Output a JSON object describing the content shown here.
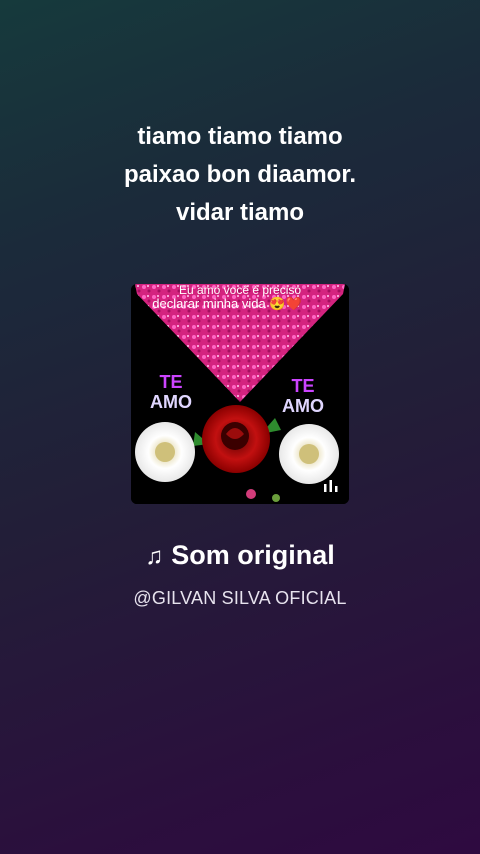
{
  "caption_lines": [
    "tiamo tiamo tiamo",
    "paixao bon diaamor.",
    "vidar tiamo"
  ],
  "thumbnail": {
    "top_text_1": "Eu amo você é preciso",
    "top_text_2": "declarar minha vida 😍❤️",
    "left_label_1": "TE",
    "left_label_2": "AMO",
    "right_label_1": "TE",
    "right_label_2": "AMO"
  },
  "sound": {
    "note_glyph": "♫",
    "title": "Som original"
  },
  "author": "@GILVAN SILVA OFICIAL",
  "icons": {
    "sound": "music-note-icon",
    "playing": "equalizer-icon"
  }
}
